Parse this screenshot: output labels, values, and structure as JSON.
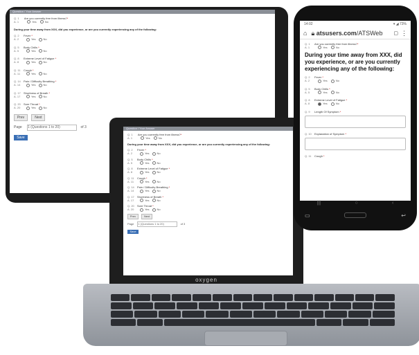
{
  "tablet": {
    "header": "Question / Your Answer",
    "q1": {
      "num": "Q. 1",
      "ans": "A. 1",
      "text": "Are you currently free from illness?"
    },
    "intro": "During your time away from XXX, did you experience, or are you currently experiencing any of the following:",
    "symptoms": [
      {
        "num": "Q. 2",
        "ans": "A. 2",
        "text": "Fever"
      },
      {
        "num": "Q. 5",
        "ans": "A. 5",
        "text": "Body Chills"
      },
      {
        "num": "Q. 8",
        "ans": "A. 8",
        "text": "Extreme Level of Fatigue"
      },
      {
        "num": "Q. 11",
        "ans": "A. 11",
        "text": "Cough"
      },
      {
        "num": "Q. 14",
        "ans": "A. 14",
        "text": "Pain / Difficulty Breathing"
      },
      {
        "num": "Q. 17",
        "ans": "A. 17",
        "text": "Shortness of Breath"
      },
      {
        "num": "Q. 20",
        "ans": "A. 20",
        "text": "Sore Throat"
      }
    ],
    "yes": "Yes",
    "no": "No",
    "prev": "Prev",
    "next": "Next",
    "page_label": "Page",
    "page_select": "1 (Questions 1 to 20)",
    "of": "of 3",
    "save": "Save"
  },
  "laptop": {
    "header": "Question / Your Answer",
    "q1": {
      "num": "Q. 1",
      "ans": "A. 1",
      "text": "Are you currently free from illness?"
    },
    "intro": "During your time away from XXX, did you experience, or are you currently experiencing any of the following:",
    "symptoms": [
      {
        "num": "Q. 2",
        "ans": "A. 2",
        "text": "Fever"
      },
      {
        "num": "Q. 5",
        "ans": "A. 5",
        "text": "Body Chills"
      },
      {
        "num": "Q. 8",
        "ans": "A. 8",
        "text": "Extreme Level of Fatigue"
      },
      {
        "num": "Q. 11",
        "ans": "A. 11",
        "text": "Cough"
      },
      {
        "num": "Q. 14",
        "ans": "A. 14",
        "text": "Pain / Difficulty Breathing"
      },
      {
        "num": "Q. 17",
        "ans": "A. 17",
        "text": "Shortness of Breath"
      },
      {
        "num": "Q. 20",
        "ans": "A. 20",
        "text": "Sore Throat"
      }
    ],
    "yes": "Yes",
    "no": "No",
    "prev": "Prev",
    "next": "Next",
    "page_label": "Page",
    "page_select": "1 (Questions 1 to 20)",
    "of": "of 3",
    "save": "Save",
    "brand": "oxygen"
  },
  "phone": {
    "time": "14:02",
    "status_icons": "▾ ◢ 73%",
    "host": "atsusers.com",
    "path": "/ATSWeb",
    "q1": {
      "num": "Q. 1",
      "ans": "A. 1",
      "text": "Are you currently free from illness?"
    },
    "intro": "During your time away from XXX, did you experience, or are you currently experiencing any of the following:",
    "fever": {
      "num": "Q. 2",
      "ans": "A. 2",
      "text": "Fever"
    },
    "chills": {
      "num": "Q. 5",
      "ans": "A. 5",
      "text": "Body Chills"
    },
    "fatigue": {
      "num": "Q. 8",
      "ans": "A. 8",
      "text": "Extreme Level of Fatigue"
    },
    "length": {
      "num": "Q. 9",
      "text": "Length Of Symptom"
    },
    "explanation": {
      "num": "Q. 10",
      "text": "Explanation of Symptom"
    },
    "cough": {
      "num": "Q. 11",
      "text": "Cough"
    },
    "yes": "Yes",
    "no": "No",
    "colors": {
      "accent": "#3a6fb5",
      "required": "#cc0000"
    }
  }
}
